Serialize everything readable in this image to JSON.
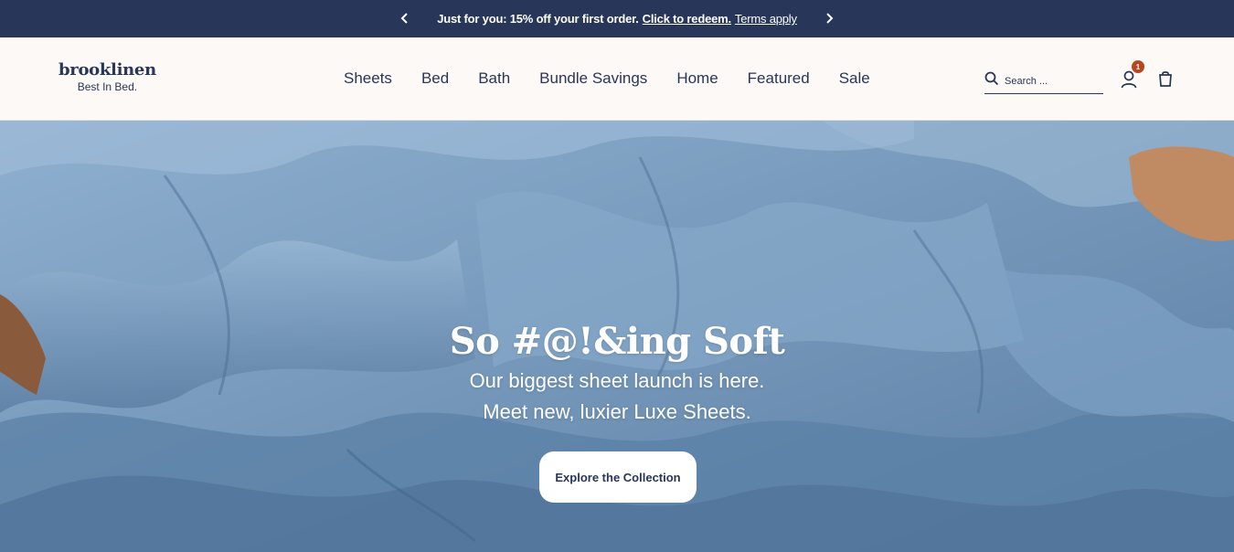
{
  "announcement": {
    "prefix": "Just for you: 15% off your first order.",
    "link_label": "Click to redeem.",
    "terms_label": "Terms apply"
  },
  "header": {
    "logo_wordmark": "brooklinen",
    "logo_tagline": "Best In Bed.",
    "nav": [
      "Sheets",
      "Bed",
      "Bath",
      "Bundle Savings",
      "Home",
      "Featured",
      "Sale"
    ],
    "search_placeholder": "Search ...",
    "cart_count": "1"
  },
  "hero": {
    "title": "So #@!&ing Soft",
    "subtitle_line1": "Our biggest sheet launch is here.",
    "subtitle_line2": "Meet new, luxier Luxe Sheets.",
    "cta_label": "Explore the Collection"
  },
  "colors": {
    "navy": "#273659",
    "cream": "#fdf9f6",
    "badge": "#b8471d",
    "sheet_blue": "#6c8fb3"
  },
  "icons": {
    "prev": "chevron-left-icon",
    "next": "chevron-right-icon",
    "search": "search-icon",
    "account": "user-icon",
    "bag": "shopping-bag-icon"
  }
}
